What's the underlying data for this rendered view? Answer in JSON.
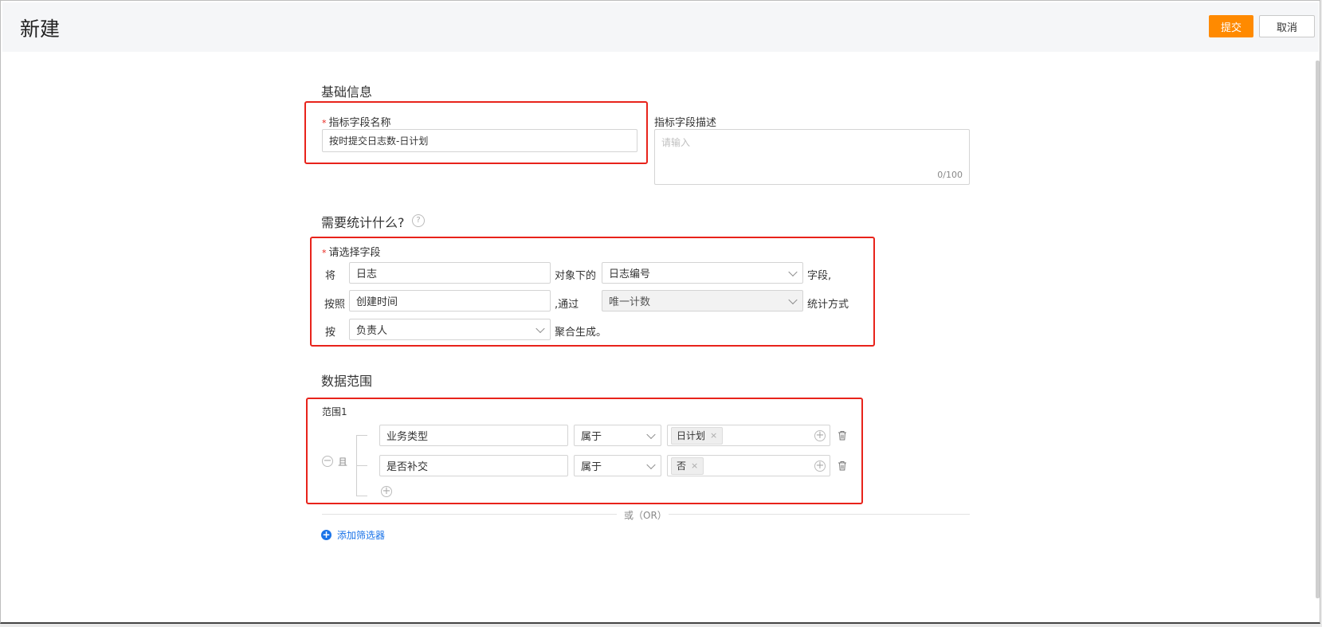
{
  "header": {
    "title": "新建",
    "submit_label": "提交",
    "cancel_label": "取消"
  },
  "basic": {
    "section_title": "基础信息",
    "name_label": "指标字段名称",
    "name_value": "按时提交日志数-日计划",
    "desc_label": "指标字段描述",
    "desc_placeholder": "请输入",
    "desc_counter": "0/100"
  },
  "stat": {
    "section_title": "需要统计什么?",
    "help_icon": "question-circle-icon",
    "select_label": "请选择字段",
    "row1": {
      "prefix": "将",
      "object": "日志",
      "mid": "对象下的",
      "field": "日志编号",
      "suffix": "字段,"
    },
    "row2": {
      "prefix": "按照",
      "field": "创建时间",
      "mid": ",通过",
      "method": "唯一计数",
      "suffix": "统计方式"
    },
    "row3": {
      "prefix": "按",
      "group": "负责人",
      "suffix": "聚合生成。"
    }
  },
  "scope": {
    "section_title": "数据范围",
    "range_label": "范围1",
    "and_label": "且",
    "conditions": [
      {
        "field": "业务类型",
        "operator": "属于",
        "value": "日计划"
      },
      {
        "field": "是否补交",
        "operator": "属于",
        "value": "否"
      }
    ],
    "or_label": "或（OR）",
    "add_filter_label": "添加筛选器"
  },
  "colors": {
    "accent": "#ff8a00",
    "highlight_box": "#e8231b",
    "link": "#1a73e8"
  }
}
